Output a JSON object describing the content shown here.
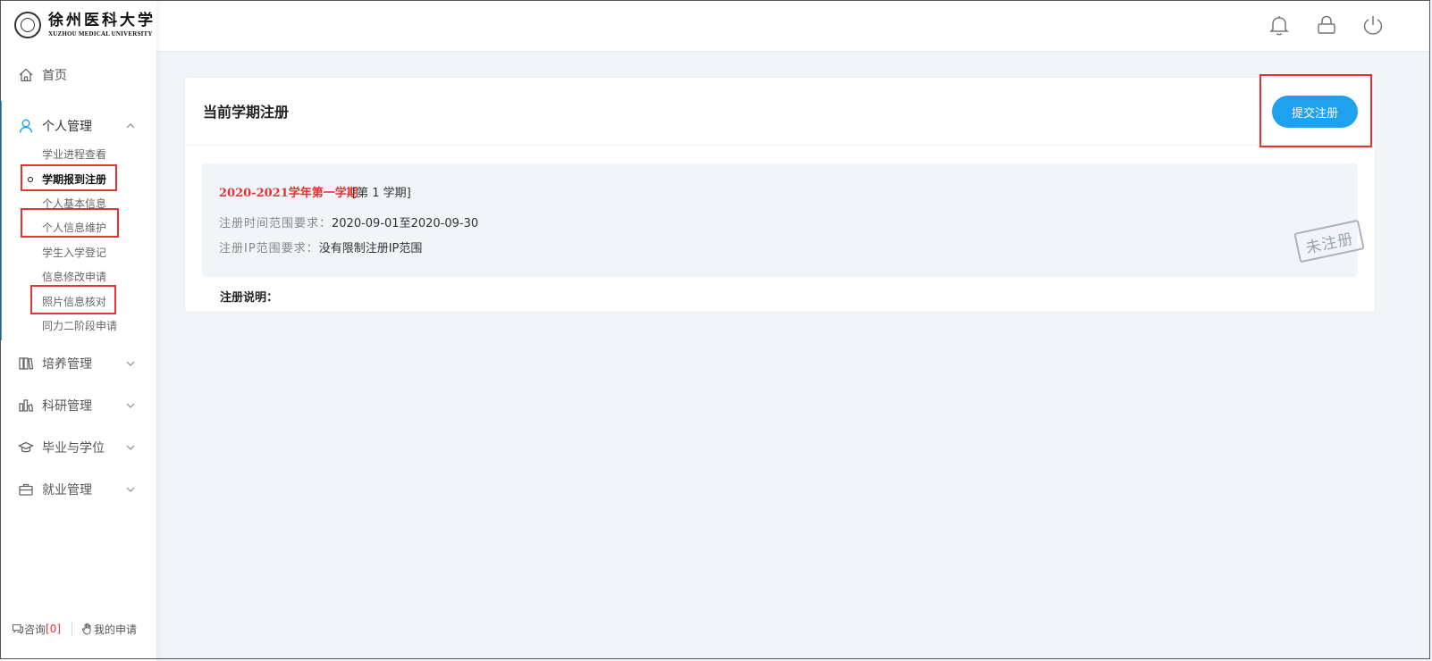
{
  "branding": {
    "name_cn": "徐州医科大学",
    "name_en": "XUZHOU MEDICAL UNIVERSITY"
  },
  "sidebar": {
    "home": {
      "label": "首页",
      "icon": "home-icon"
    },
    "personal": {
      "label": "个人管理",
      "icon": "user-icon",
      "expanded": true,
      "items": [
        {
          "label": "学业进程查看"
        },
        {
          "label": "学期报到注册",
          "selected": true
        },
        {
          "label": "个人基本信息"
        },
        {
          "label": "个人信息维护"
        },
        {
          "label": "学生入学登记"
        },
        {
          "label": "信息修改申请"
        },
        {
          "label": "照片信息核对"
        },
        {
          "label": "同力二阶段申请"
        }
      ]
    },
    "training": {
      "label": "培养管理",
      "icon": "books-icon"
    },
    "research": {
      "label": "科研管理",
      "icon": "research-icon"
    },
    "graduation": {
      "label": "毕业与学位",
      "icon": "graduation-cap-icon"
    },
    "employment": {
      "label": "就业管理",
      "icon": "briefcase-icon"
    },
    "footer": {
      "consult_label": "咨询",
      "consult_count": "[0]",
      "my_apply_label": "我的申请"
    }
  },
  "topbar": {
    "icons": [
      "bell-icon",
      "lock-icon",
      "power-icon"
    ]
  },
  "main": {
    "card_title": "当前学期注册",
    "submit_label": "提交注册",
    "term": {
      "name": "2020-2021学年第一学期",
      "index": "[第 1 学期]",
      "time_key": "注册时间范围要求：",
      "time_value": "2020-09-01至2020-09-30",
      "ip_key": "注册IP范围要求：",
      "ip_value": "没有限制注册IP范围",
      "stamp": "未注册"
    },
    "note_title": "注册说明："
  },
  "colors": {
    "accent": "#1ea1ef",
    "highlight": "#e53333",
    "term_name": "#e53333",
    "background": "#f1f4f8"
  }
}
